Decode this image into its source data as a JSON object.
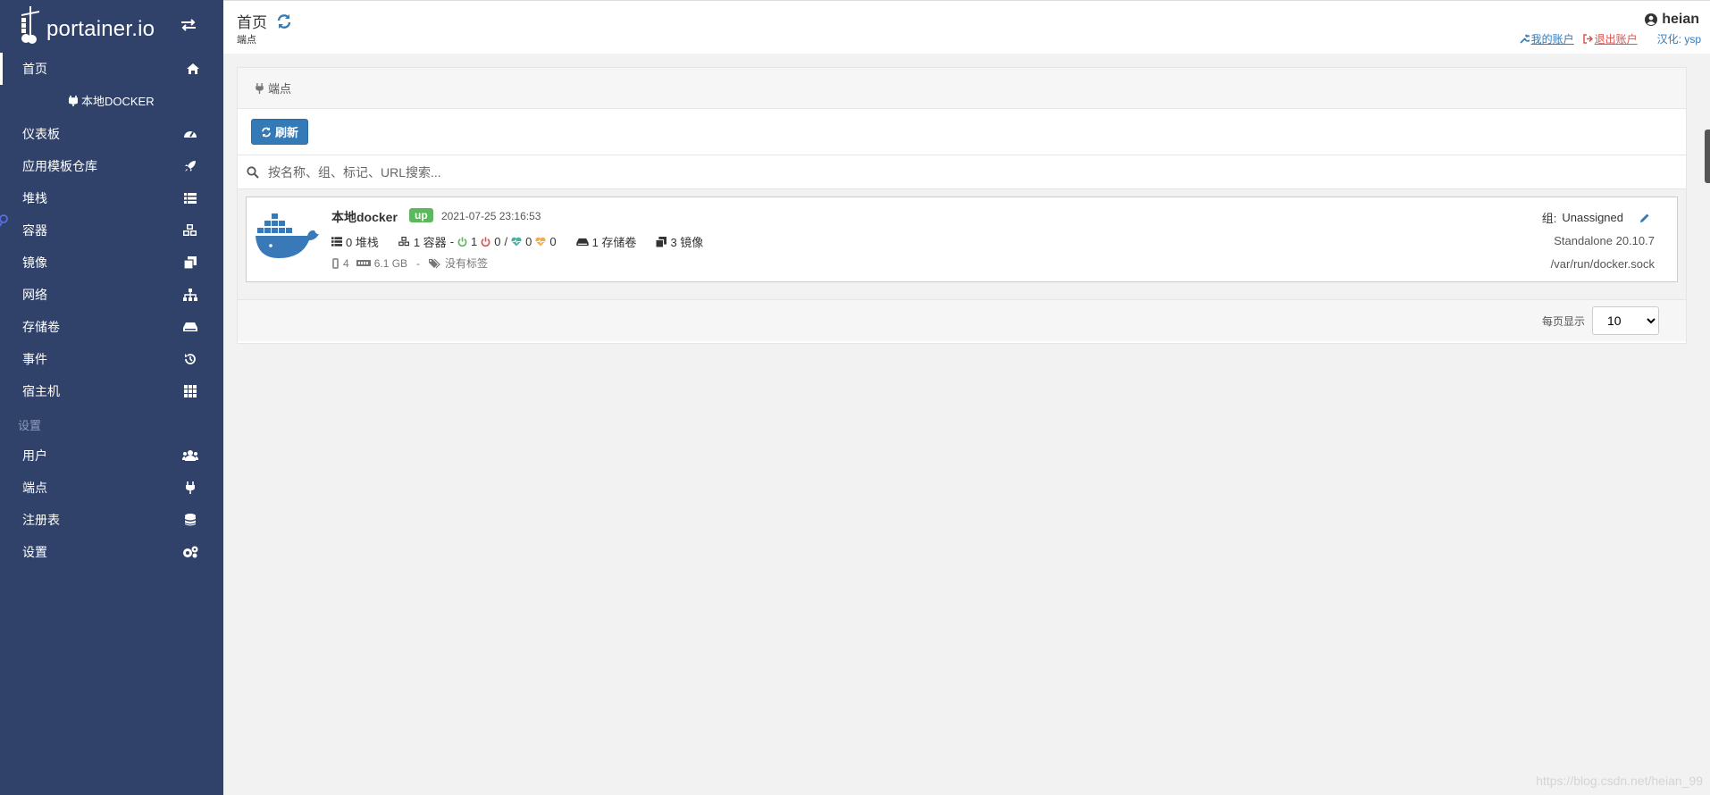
{
  "brand": {
    "name": "portainer.io"
  },
  "sidebar": {
    "home": "首页",
    "endpoint_header": "本地DOCKER",
    "items": [
      {
        "label": "仪表板",
        "icon": "tachometer-icon"
      },
      {
        "label": "应用模板仓库",
        "icon": "rocket-icon"
      },
      {
        "label": "堆栈",
        "icon": "th-list-icon"
      },
      {
        "label": "容器",
        "icon": "cubes-icon"
      },
      {
        "label": "镜像",
        "icon": "clone-icon"
      },
      {
        "label": "网络",
        "icon": "sitemap-icon"
      },
      {
        "label": "存储卷",
        "icon": "hdd-icon"
      },
      {
        "label": "事件",
        "icon": "history-icon"
      },
      {
        "label": "宿主机",
        "icon": "th-icon"
      }
    ],
    "settings_section": "设置",
    "settings_items": [
      {
        "label": "用户",
        "icon": "users-icon"
      },
      {
        "label": "端点",
        "icon": "plug-icon"
      },
      {
        "label": "注册表",
        "icon": "database-icon"
      },
      {
        "label": "设置",
        "icon": "cogs-icon"
      }
    ]
  },
  "header": {
    "title": "首页",
    "subtitle": "端点",
    "username": "heian",
    "my_account": "我的账户",
    "logout": "退出账户",
    "credit": "汉化: ysp"
  },
  "panel": {
    "title": "端点",
    "refresh_label": "刷新",
    "search_placeholder": "按名称、组、标记、URL搜索..."
  },
  "endpoint": {
    "name": "本地docker",
    "status": "up",
    "timestamp": "2021-07-25 23:16:53",
    "stacks": "0 堆栈",
    "containers": "1 容器",
    "running": "1",
    "stopped": "0",
    "healthy": "0",
    "unhealthy": "0",
    "volumes": "1 存储卷",
    "images": "3 镜像",
    "cpu": "4",
    "memory": "6.1 GB",
    "tags": "没有标签",
    "group_label": "组:",
    "group": "Unassigned",
    "version": "Standalone 20.10.7",
    "url": "/var/run/docker.sock"
  },
  "pagination": {
    "label": "每页显示",
    "value": "10"
  },
  "watermark": "https://blog.csdn.net/heian_99",
  "colors": {
    "sidebar": "#30426a",
    "primary": "#337ab7",
    "success": "#5cb85c",
    "danger": "#d9534f"
  }
}
